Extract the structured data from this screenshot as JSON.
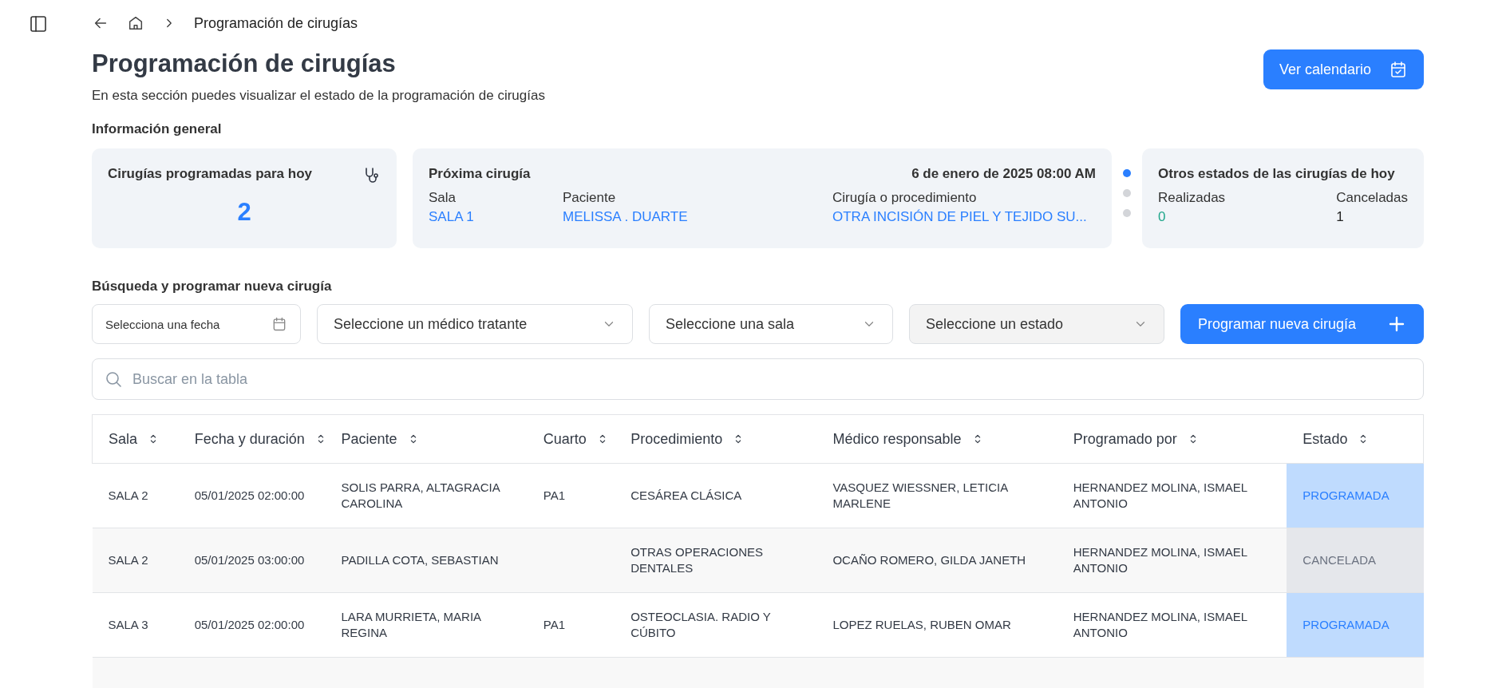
{
  "breadcrumb": {
    "current": "Programación de cirugías"
  },
  "header": {
    "title": "Programación de cirugías",
    "subtitle": "En esta sección puedes visualizar el estado de la programación de cirugías",
    "button": "Ver calendario"
  },
  "general_info": {
    "heading": "Información general",
    "today_card": {
      "title": "Cirugías programadas para hoy",
      "count": "2"
    },
    "next_card": {
      "title": "Próxima cirugía",
      "datetime": "6 de enero de 2025 08:00 AM",
      "fields": [
        {
          "label": "Sala",
          "value": "SALA 1"
        },
        {
          "label": "Paciente",
          "value": "MELISSA . DUARTE"
        },
        {
          "label": "Cirugía o procedimiento",
          "value": "OTRA INCISIÓN DE PIEL Y TEJIDO SU..."
        }
      ]
    },
    "pager_dots": [
      {
        "selected": true
      },
      {
        "selected": false
      },
      {
        "selected": false
      }
    ],
    "other_card": {
      "title": "Otros estados de las cirugías de hoy",
      "stats": [
        {
          "label": "Realizadas",
          "value": "0",
          "kind": "done"
        },
        {
          "label": "Canceladas",
          "value": "1",
          "kind": "cancelled"
        }
      ]
    }
  },
  "search_section": {
    "heading": "Búsqueda y programar nueva cirugía",
    "date_field": {
      "placeholder": "Selecciona una fecha"
    },
    "selects": [
      {
        "placeholder": "Seleccione un médico tratante",
        "disabled": false
      },
      {
        "placeholder": "Seleccione una sala",
        "disabled": false
      },
      {
        "placeholder": "Seleccione un estado",
        "disabled": true
      }
    ],
    "new_button": "Programar nueva cirugía",
    "table_search": {
      "placeholder": "Buscar en la tabla"
    }
  },
  "table": {
    "columns": [
      "Sala",
      "Fecha y duración",
      "Paciente",
      "Cuarto",
      "Procedimiento",
      "Médico responsable",
      "Programado por",
      "Estado"
    ],
    "rows": [
      {
        "cells": [
          "SALA 2",
          "05/01/2025 02:00:00",
          "SOLIS PARRA, ALTAGRACIA CAROLINA",
          "PA1",
          "CESÁREA CLÁSICA",
          "VASQUEZ WIESSNER, LETICIA MARLENE",
          "HERNANDEZ MOLINA, ISMAEL ANTONIO"
        ],
        "status": {
          "label": "PROGRAMADA",
          "kind": "scheduled"
        }
      },
      {
        "cells": [
          "SALA 2",
          "05/01/2025 03:00:00",
          "PADILLA COTA, SEBASTIAN",
          "",
          "OTRAS OPERACIONES DENTALES",
          "OCAÑO ROMERO, GILDA JANETH",
          "HERNANDEZ MOLINA, ISMAEL ANTONIO"
        ],
        "status": {
          "label": "CANCELADA",
          "kind": "cancelled"
        }
      },
      {
        "cells": [
          "SALA 3",
          "05/01/2025 02:00:00",
          "LARA MURRIETA, MARIA REGINA",
          "PA1",
          "OSTEOCLASIA. RADIO Y CÚBITO",
          "LOPEZ RUELAS, RUBEN OMAR",
          "HERNANDEZ MOLINA, ISMAEL ANTONIO"
        ],
        "status": {
          "label": "PROGRAMADA",
          "kind": "scheduled"
        }
      }
    ]
  }
}
